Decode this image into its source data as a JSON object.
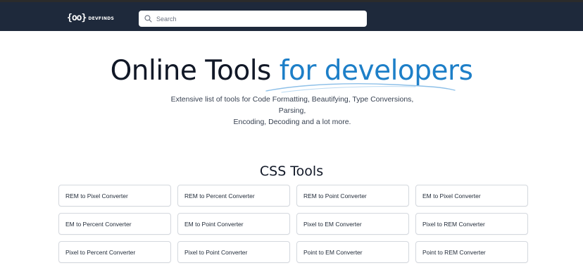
{
  "header": {
    "logo_mark": "{oo}",
    "logo_text": "DEVFINDS",
    "search_placeholder": "Search",
    "background_color": "#1e293b"
  },
  "hero": {
    "title_part1": "Online Tools ",
    "title_accent": "for developers",
    "accent_color": "#1d7fc8",
    "subtitle_line1": "Extensive list of tools for Code Formatting, Beautifying, Type Conversions, Parsing,",
    "subtitle_line2": "Encoding, Decoding and a lot more."
  },
  "css_tools": {
    "title": "CSS Tools",
    "items": [
      "REM to Pixel Converter",
      "REM to Percent Converter",
      "REM to Point Converter",
      "EM to Pixel Converter",
      "EM to Percent Converter",
      "EM to Point Converter",
      "Pixel to EM Converter",
      "Pixel to REM Converter",
      "Pixel to Percent Converter",
      "Pixel to Point Converter",
      "Point to EM Converter",
      "Point to REM Converter"
    ]
  },
  "icons": {
    "search": "search-icon",
    "logo": "devfinds-logo-icon"
  }
}
